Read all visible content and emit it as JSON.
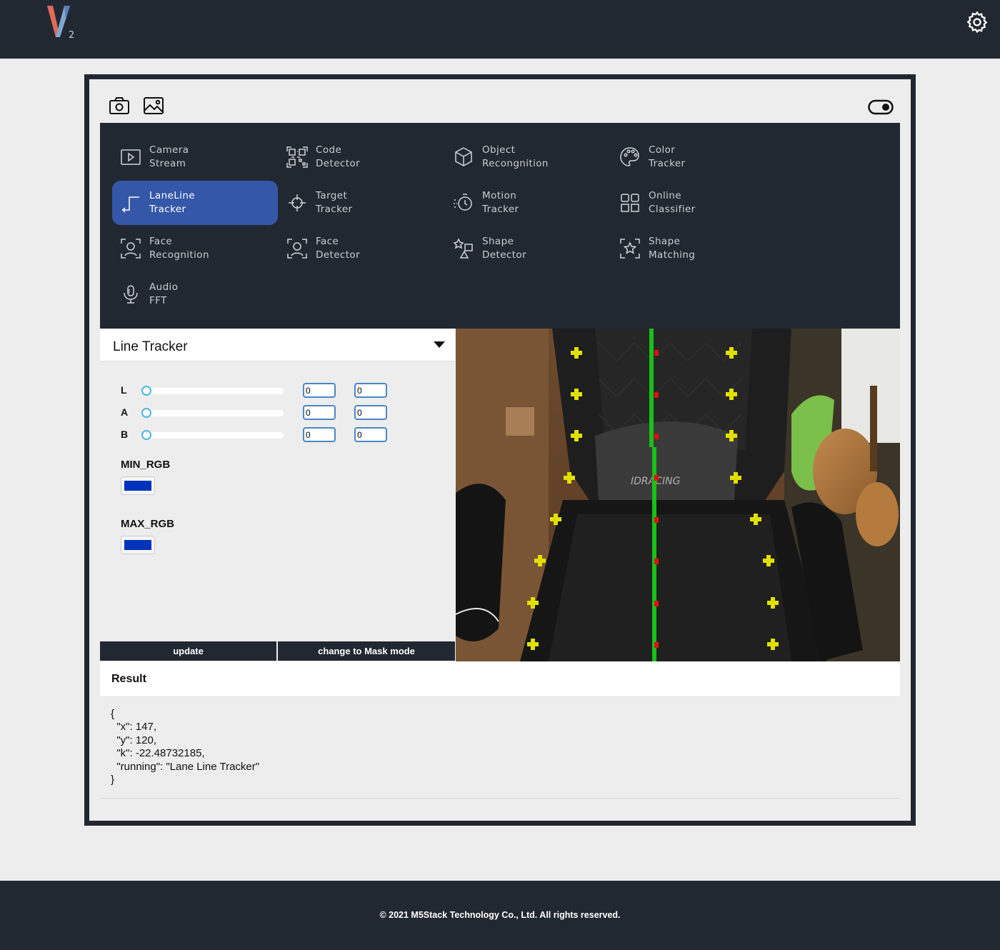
{
  "app": {
    "logo_text": "V",
    "logo_sub": "2"
  },
  "toolbar": {
    "icons": [
      "camera-icon",
      "image-icon",
      "toggle-switch-icon"
    ]
  },
  "menu": {
    "items": [
      {
        "line1": "Camera",
        "line2": "Stream",
        "icon": "play-screen-icon"
      },
      {
        "line1": "Code",
        "line2": "Detector",
        "icon": "qr-code-icon"
      },
      {
        "line1": "Object",
        "line2": "Recongnition",
        "icon": "cube-icon"
      },
      {
        "line1": "Color",
        "line2": "Tracker",
        "icon": "palette-icon"
      },
      {
        "line1": "LaneLine",
        "line2": "Tracker",
        "icon": "lane-line-icon",
        "active": true
      },
      {
        "line1": "Target",
        "line2": "Tracker",
        "icon": "crosshair-icon"
      },
      {
        "line1": "Motion",
        "line2": "Tracker",
        "icon": "motion-circle-icon"
      },
      {
        "line1": "Online",
        "line2": "Classifier",
        "icon": "grid-squares-icon"
      },
      {
        "line1": "Face",
        "line2": "Recognition",
        "icon": "face-scan-icon"
      },
      {
        "line1": "Face",
        "line2": "Detector",
        "icon": "face-scan-icon"
      },
      {
        "line1": "Shape",
        "line2": "Detector",
        "icon": "shapes-icon"
      },
      {
        "line1": "Shape",
        "line2": "Matching",
        "icon": "star-scan-icon"
      },
      {
        "line1": "Audio",
        "line2": "FFT",
        "icon": "microphone-icon"
      }
    ]
  },
  "panel": {
    "title": "Line Tracker",
    "lab": [
      {
        "label": "L",
        "slider": 0,
        "min": "0",
        "max": "0"
      },
      {
        "label": "A",
        "slider": 0,
        "min": "0",
        "max": "0"
      },
      {
        "label": "B",
        "slider": 0,
        "min": "0",
        "max": "0"
      }
    ],
    "min_rgb_label": "MIN_RGB",
    "min_rgb_color": "#0033bb",
    "max_rgb_label": "MAX_RGB",
    "max_rgb_color": "#0033bb",
    "update_label": "update",
    "mask_label": "change to Mask mode"
  },
  "result": {
    "title": "Result",
    "lines": [
      "{",
      "  \"x\": 147,",
      "  \"y\": 120,",
      "  \"k\": -22.48732185,",
      "  \"running\": \"Lane Line Tracker\"",
      "}"
    ]
  },
  "footer": {
    "copyright": "© 2021 M5Stack Technology Co., Ltd. All rights reserved."
  },
  "colors": {
    "dark": "#222831",
    "active": "#3557a8",
    "lane_line": "#18c018",
    "marker_yellow": "#e0e000",
    "marker_red": "#e01010"
  }
}
